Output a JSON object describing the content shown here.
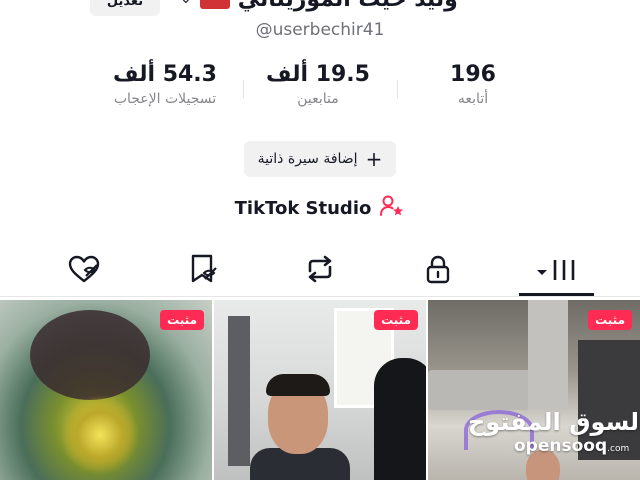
{
  "header": {
    "edit_label": "تعديل",
    "display_name": "وليد حيث الموريتاني",
    "username": "@userbechir41"
  },
  "stats": {
    "likes": {
      "value": "54.3 ألف",
      "label": "تسجيلات الإعجاب"
    },
    "followers": {
      "value": "19.5 ألف",
      "label": "متابعين"
    },
    "following": {
      "value": "196",
      "label": "أتابعه"
    }
  },
  "add_bio": {
    "icon": "plus-icon",
    "label": "إضافة سيرة ذاتية"
  },
  "studio": {
    "label": "TikTok Studio",
    "icon": "person-star-icon"
  },
  "tabs": [
    {
      "name": "videos",
      "icon": "grid-icon",
      "active": true
    },
    {
      "name": "private",
      "icon": "lock-icon",
      "active": false
    },
    {
      "name": "reposts",
      "icon": "repost-icon",
      "active": false
    },
    {
      "name": "favorites",
      "icon": "bookmark-icon",
      "active": false
    },
    {
      "name": "liked",
      "icon": "heart-icon",
      "active": false
    }
  ],
  "videos": [
    {
      "pinned_label": "مثبت"
    },
    {
      "pinned_label": "مثبت"
    },
    {
      "pinned_label": "مثبت",
      "watermark_ar": "السوق المفتوح",
      "watermark_latin": "opensooq",
      "watermark_suffix": ".com"
    }
  ],
  "colors": {
    "accent": "#fe2c55",
    "text_primary": "#161823",
    "text_secondary": "#86878b",
    "chip_bg": "#f1f1f2"
  }
}
